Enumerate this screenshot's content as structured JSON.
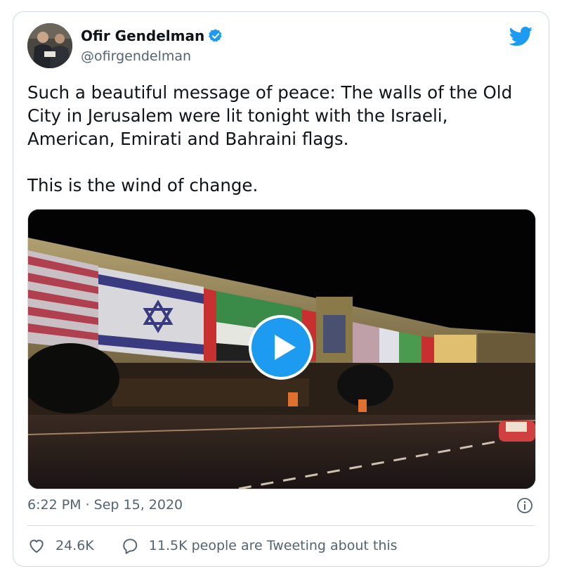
{
  "author": {
    "name": "Ofir Gendelman",
    "handle": "@ofirgendelman",
    "verified": true
  },
  "tweet": {
    "text": "Such a beautiful message of peace: The walls of the Old City in Jerusalem were lit tonight with the Israeli, American, Emirati and Bahraini flags.\n\nThis is the wind of change.",
    "timestamp": "6:22 PM · Sep 15, 2020"
  },
  "media": {
    "type": "video",
    "play_icon": "play-icon"
  },
  "actions": {
    "likes": "24.6K",
    "tweeting_text": "11.5K people are Tweeting about this"
  },
  "colors": {
    "accent": "#1d9bf0",
    "text": "#0f1419",
    "secondary": "#536471",
    "border": "#cfd9de"
  }
}
